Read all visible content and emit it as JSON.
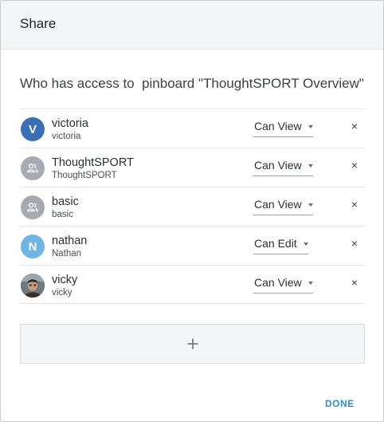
{
  "dialog": {
    "title": "Share",
    "access_title": "Who has access to  pinboard \"ThoughtSPORT Overview\"",
    "done_label": "DONE"
  },
  "colors": {
    "victoria_avatar": "#3a6fb7",
    "group_avatar": "#a6aab1",
    "nathan_avatar": "#6fb5e4",
    "done_link": "#2f8ad8"
  },
  "icons": {
    "group": "group-icon",
    "remove": "close-icon",
    "caret": "chevron-down-icon",
    "add": "plus-icon"
  },
  "users": [
    {
      "name": "victoria",
      "sub": "victoria",
      "initial": "V",
      "permission": "Can View",
      "remove": "×"
    },
    {
      "name": "ThoughtSPORT",
      "sub": "ThoughtSPORT",
      "permission": "Can View",
      "remove": "×"
    },
    {
      "name": "basic",
      "sub": "basic",
      "permission": "Can View",
      "remove": "×"
    },
    {
      "name": "nathan",
      "sub": "Nathan",
      "initial": "N",
      "permission": "Can Edit",
      "remove": "×"
    },
    {
      "name": "vicky",
      "sub": "vicky",
      "permission": "Can View",
      "remove": "×"
    }
  ]
}
